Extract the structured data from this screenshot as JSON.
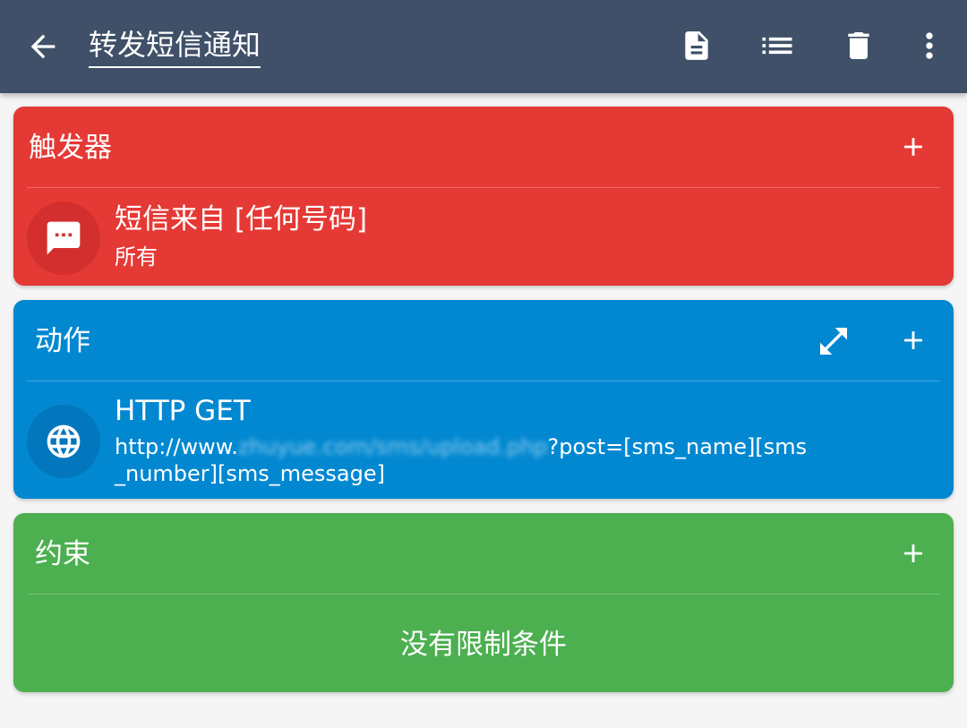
{
  "appbar": {
    "title": "转发短信通知",
    "actions": [
      "document-icon",
      "list-icon",
      "delete-icon",
      "more-vertical-icon"
    ]
  },
  "trigger": {
    "header": "触发器",
    "color": "#e53935",
    "item": {
      "icon": "message-icon",
      "title": "短信来自 [任何号码]",
      "subtitle": "所有"
    }
  },
  "action": {
    "header": "动作",
    "color": "#0288d1",
    "item": {
      "icon": "globe-icon",
      "title": "HTTP GET",
      "url_prefix": "http://www.",
      "url_blurred": "zhuyue.com/sms/upload.php",
      "url_suffix_line1": "?post=[sms_name][sms",
      "url_line2": "_number][sms_message]"
    }
  },
  "constraint": {
    "header": "约束",
    "color": "#4caf50",
    "empty_text": "没有限制条件"
  }
}
